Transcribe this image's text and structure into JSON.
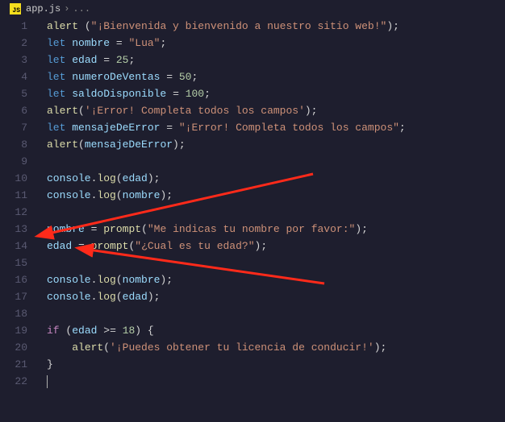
{
  "breadcrumb": {
    "filename": "app.js",
    "more": "..."
  },
  "jsIconText": "JS",
  "lineNumbers": [
    "1",
    "2",
    "3",
    "4",
    "5",
    "6",
    "7",
    "8",
    "9",
    "10",
    "11",
    "12",
    "13",
    "14",
    "15",
    "16",
    "17",
    "18",
    "19",
    "20",
    "21",
    "22"
  ],
  "code": {
    "l1": {
      "fn": "alert",
      "str": "\"¡Bienvenida y bienvenido a nuestro sitio web!\""
    },
    "l2": {
      "kw": "let",
      "var": "nombre",
      "val": "\"Lua\""
    },
    "l3": {
      "kw": "let",
      "var": "edad",
      "val": "25"
    },
    "l4": {
      "kw": "let",
      "var": "numeroDeVentas",
      "val": "50"
    },
    "l5": {
      "kw": "let",
      "var": "saldoDisponible",
      "val": "100"
    },
    "l6": {
      "fn": "alert",
      "str": "'¡Error! Completa todos los campos'"
    },
    "l7": {
      "kw": "let",
      "var": "mensajeDeError",
      "val": "\"¡Error! Completa todos los campos\""
    },
    "l8": {
      "fn": "alert",
      "arg": "mensajeDeError"
    },
    "l10": {
      "obj": "console",
      "fn": "log",
      "arg": "edad"
    },
    "l11": {
      "obj": "console",
      "fn": "log",
      "arg": "nombre"
    },
    "l13": {
      "var": "nombre",
      "fn": "prompt",
      "str": "\"Me indicas tu nombre por favor:\""
    },
    "l14": {
      "var": "edad",
      "fn": "prompt",
      "str": "\"¿Cual es tu edad?\""
    },
    "l16": {
      "obj": "console",
      "fn": "log",
      "arg": "nombre"
    },
    "l17": {
      "obj": "console",
      "fn": "log",
      "arg": "edad"
    },
    "l19": {
      "kw": "if",
      "cond_var": "edad",
      "cond_op": ">=",
      "cond_num": "18"
    },
    "l20": {
      "fn": "alert",
      "str": "'¡Puedes obtener tu licencia de conducir!'"
    },
    "l21": {
      "brace": "}"
    }
  }
}
